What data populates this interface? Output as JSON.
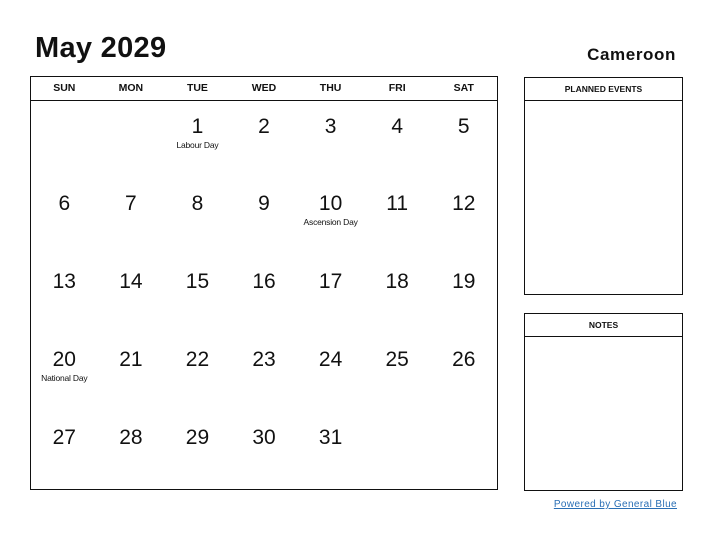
{
  "header": {
    "title": "May 2029",
    "country": "Cameroon"
  },
  "calendar": {
    "weekdays": [
      "SUN",
      "MON",
      "TUE",
      "WED",
      "THU",
      "FRI",
      "SAT"
    ],
    "weeks": [
      [
        {
          "n": ""
        },
        {
          "n": ""
        },
        {
          "n": "1",
          "h": "Labour Day"
        },
        {
          "n": "2"
        },
        {
          "n": "3"
        },
        {
          "n": "4"
        },
        {
          "n": "5"
        }
      ],
      [
        {
          "n": "6"
        },
        {
          "n": "7"
        },
        {
          "n": "8"
        },
        {
          "n": "9"
        },
        {
          "n": "10",
          "h": "Ascension Day"
        },
        {
          "n": "11"
        },
        {
          "n": "12"
        }
      ],
      [
        {
          "n": "13"
        },
        {
          "n": "14"
        },
        {
          "n": "15"
        },
        {
          "n": "16"
        },
        {
          "n": "17"
        },
        {
          "n": "18"
        },
        {
          "n": "19"
        }
      ],
      [
        {
          "n": "20",
          "h": "National Day"
        },
        {
          "n": "21"
        },
        {
          "n": "22"
        },
        {
          "n": "23"
        },
        {
          "n": "24"
        },
        {
          "n": "25"
        },
        {
          "n": "26"
        }
      ],
      [
        {
          "n": "27"
        },
        {
          "n": "28"
        },
        {
          "n": "29"
        },
        {
          "n": "30"
        },
        {
          "n": "31"
        },
        {
          "n": ""
        },
        {
          "n": ""
        }
      ]
    ]
  },
  "panels": {
    "planned_events": "PLANNED EVENTS",
    "notes": "NOTES"
  },
  "footer": {
    "powered_by": "Powered by General Blue",
    "link_color": "#2a6fb5"
  }
}
